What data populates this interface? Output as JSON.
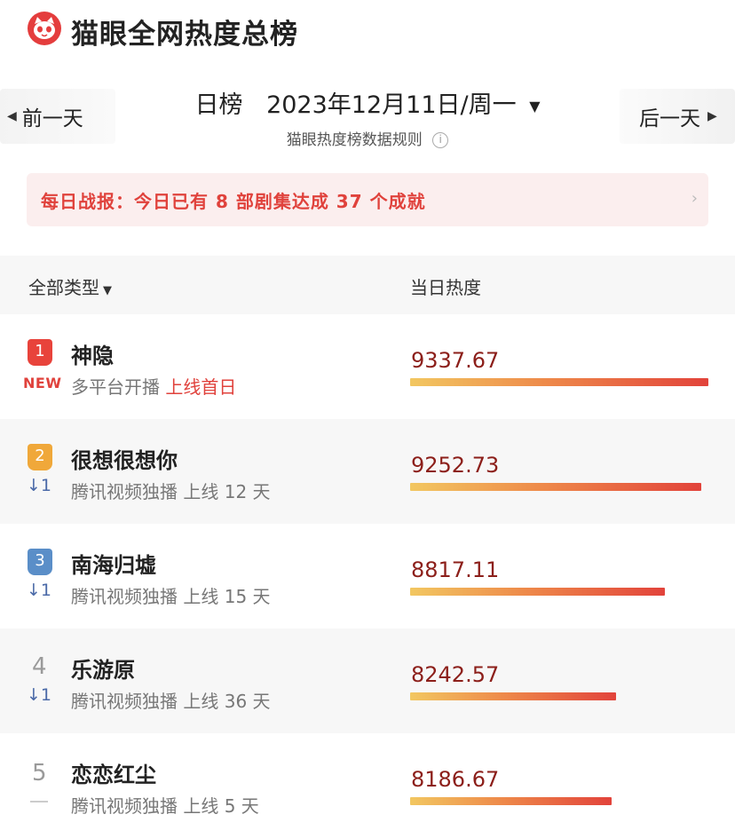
{
  "header": {
    "title": "猫眼全网热度总榜",
    "logo_icon": "cat-face-icon",
    "brand_color": "#e43d3d"
  },
  "date_nav": {
    "prev_label": "前一天",
    "next_label": "后一天",
    "tab_label": "日榜",
    "date": "2023年12月11日/周一",
    "rules_link": "猫眼热度榜数据规则"
  },
  "banner": {
    "text": "每日战报：今日已有 8 部剧集达成 37 个成就"
  },
  "list_header": {
    "filter_label": "全部类型",
    "heat_label": "当日热度"
  },
  "rankings": [
    {
      "rank": "1",
      "status": "NEW",
      "title": "神隐",
      "platform": "多平台开播",
      "online": "上线首日",
      "heat": "9337.67",
      "heat_value": 9337.67
    },
    {
      "rank": "2",
      "status": "↓1",
      "title": "很想很想你",
      "platform": "腾讯视频独播",
      "online": "上线 12 天",
      "heat": "9252.73",
      "heat_value": 9252.73
    },
    {
      "rank": "3",
      "status": "↓1",
      "title": "南海归墟",
      "platform": "腾讯视频独播",
      "online": "上线 15 天",
      "heat": "8817.11",
      "heat_value": 8817.11
    },
    {
      "rank": "4",
      "status": "↓1",
      "title": "乐游原",
      "platform": "腾讯视频独播",
      "online": "上线 36 天",
      "heat": "8242.57",
      "heat_value": 8242.57
    },
    {
      "rank": "5",
      "status": "",
      "title": "恋恋红尘",
      "platform": "腾讯视频独播",
      "online": "上线 5 天",
      "heat": "8186.67",
      "heat_value": 8186.67
    }
  ]
}
